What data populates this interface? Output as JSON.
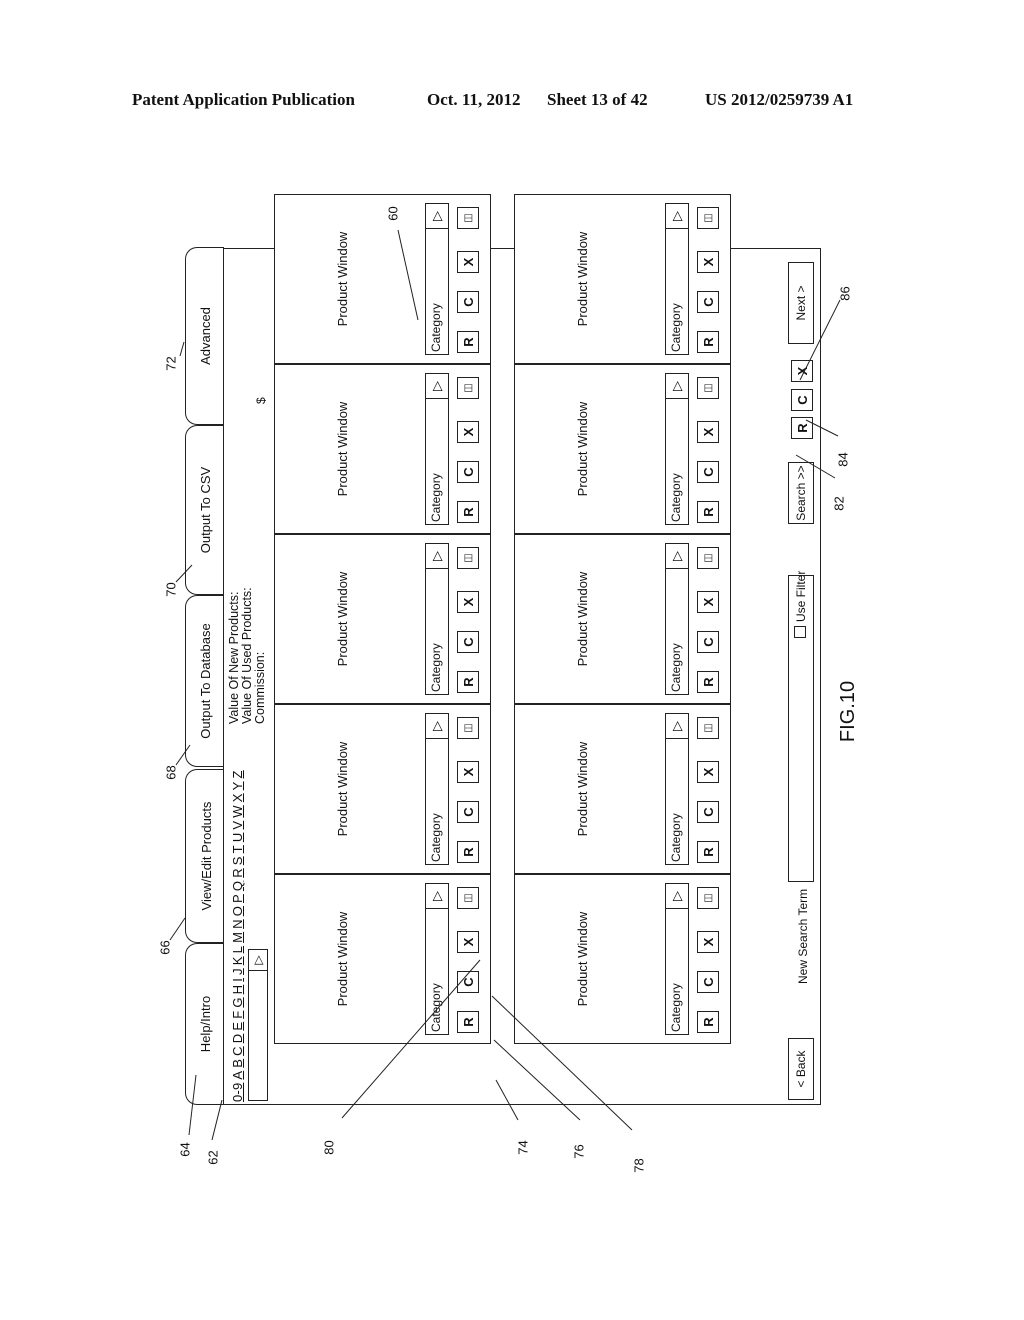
{
  "header": {
    "publication": "Patent Application Publication",
    "date": "Oct. 11, 2012",
    "sheet": "Sheet 13 of 42",
    "number": "US 2012/0259739 A1"
  },
  "tabs": [
    {
      "label": "Help/Intro"
    },
    {
      "label": "View/Edit Products"
    },
    {
      "label": "Output To Database"
    },
    {
      "label": "Output To CSV"
    },
    {
      "label": "Advanced"
    }
  ],
  "alpha_nav": [
    "0-9",
    "A",
    "B",
    "C",
    "D",
    "E",
    "F",
    "G",
    "H",
    "I",
    "J",
    "K",
    "L",
    "M",
    "N",
    "O",
    "P",
    "Q",
    "R",
    "S",
    "T",
    "U",
    "V",
    "W",
    "X",
    "Y",
    "Z"
  ],
  "summary": {
    "new_label": "Value Of New Products:",
    "used_label": "Value Of Used Products:",
    "commission_label": "Commission:",
    "currency": "$"
  },
  "product_window": {
    "title": "Product Window",
    "category": "Category",
    "dropdown_icon": "triangle-right-icon",
    "buttons": [
      "R",
      "C",
      "X"
    ],
    "minimize_icon": "minimize-window-icon"
  },
  "product_windows_count": 10,
  "bottom_bar": {
    "back": "< Back",
    "search_label": "New Search Term",
    "search_value": "",
    "use_filter": "Use Filter",
    "search_button": "Search >>",
    "r": "R",
    "c": "C",
    "x": "X",
    "next": "Next >"
  },
  "refs": {
    "r60": "60",
    "r62": "62",
    "r64": "64",
    "r66": "66",
    "r68": "68",
    "r70": "70",
    "r72": "72",
    "r74": "74",
    "r76": "76",
    "r78": "78",
    "r80": "80",
    "r82": "82",
    "r84": "84",
    "r86": "86"
  },
  "figure_label": "FIG.10"
}
